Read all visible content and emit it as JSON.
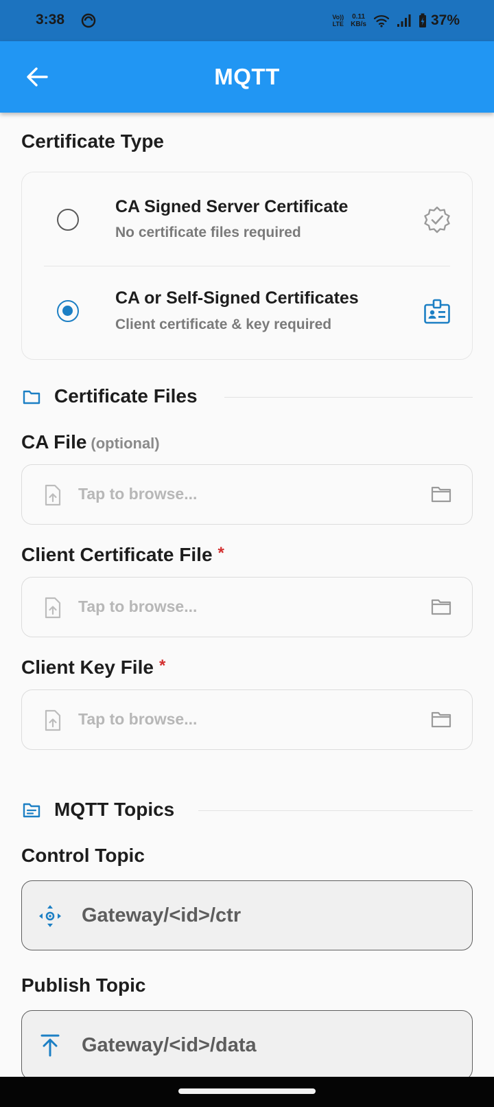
{
  "status_bar": {
    "time": "3:38",
    "volte_top": "Vo))",
    "volte_bottom": "LTE",
    "net_speed": "0.11",
    "net_unit": "KB/s",
    "battery": "37%"
  },
  "app_bar": {
    "title": "MQTT",
    "back_icon": "arrow-left-icon"
  },
  "certificate_type": {
    "title": "Certificate Type",
    "options": [
      {
        "name": "CA Signed Server Certificate",
        "description": "No certificate files required",
        "selected": false,
        "icon": "verified-badge-icon"
      },
      {
        "name": "CA or Self-Signed Certificates",
        "description": "Client certificate & key required",
        "selected": true,
        "icon": "badge-id-icon"
      }
    ]
  },
  "certificate_files": {
    "title": "Certificate Files",
    "icon": "folder-icon",
    "fields": [
      {
        "label": "CA File",
        "optional_text": "(optional)",
        "placeholder": "Tap to browse..."
      },
      {
        "label": "Client Certificate File",
        "required_mark": "*",
        "placeholder": "Tap to browse..."
      },
      {
        "label": "Client Key File",
        "required_mark": "*",
        "placeholder": "Tap to browse..."
      }
    ]
  },
  "mqtt_topics": {
    "title": "MQTT Topics",
    "icon": "topic-icon",
    "control": {
      "label": "Control Topic",
      "value": "Gateway/<id>/ctr",
      "icon": "move-arrows-icon"
    },
    "publish": {
      "label": "Publish Topic",
      "value": "Gateway/<id>/data",
      "icon": "upload-icon"
    }
  },
  "colors": {
    "status_bar": "#1c73bf",
    "app_bar": "#2196f3",
    "accent": "#1c7fc4",
    "required": "#d32f2f"
  }
}
